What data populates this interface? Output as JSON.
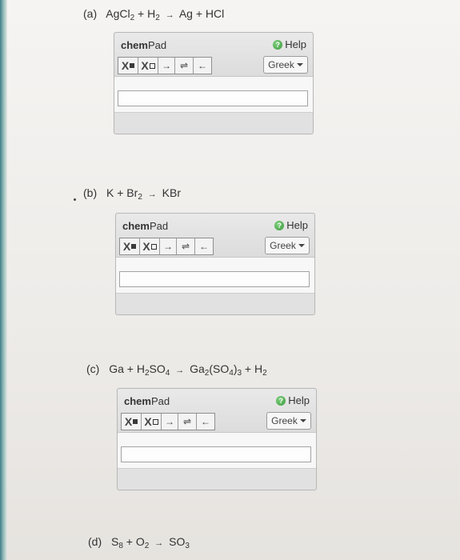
{
  "questions": [
    {
      "label": "(a)",
      "parts": [
        "AgCl",
        "2",
        " + H",
        "2",
        "Ag + HCl"
      ]
    },
    {
      "label": "(b)",
      "parts": [
        "K + Br",
        "2",
        "KBr"
      ]
    },
    {
      "label": "(c)",
      "parts": [
        "Ga + H",
        "2",
        "SO",
        "4",
        "Ga",
        "2",
        "(SO",
        "4",
        ")",
        "3",
        " + H",
        "2"
      ]
    },
    {
      "label": "(d)",
      "parts": [
        "S",
        "8",
        " + O",
        "2",
        "SO",
        "3"
      ]
    }
  ],
  "arrow": "→",
  "chempad": {
    "title_bold": "chem",
    "title_rest": "Pad",
    "help_label": "Help",
    "help_icon": "?",
    "greek_label": "Greek",
    "toolbar": {
      "sub": "X",
      "sup": "X",
      "arrow": "→",
      "equilibrium": "⇌",
      "back": "←"
    }
  }
}
